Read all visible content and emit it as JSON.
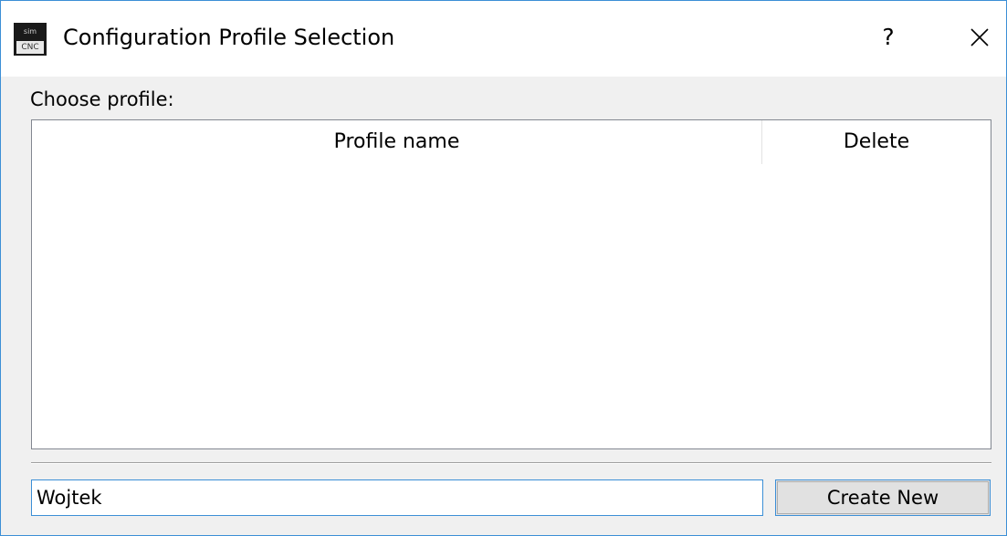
{
  "window": {
    "title": "Configuration Profile Selection",
    "app_icon": {
      "top_text": "sim",
      "bottom_text": "CNC"
    },
    "help_label": "?",
    "close_icon": "close-icon"
  },
  "content": {
    "choose_label": "Choose profile:",
    "table": {
      "columns": [
        "Profile name",
        "Delete"
      ],
      "rows": []
    },
    "name_input": {
      "value": "Wojtek"
    },
    "create_button_label": "Create New"
  },
  "colors": {
    "accent": "#3c8fd6",
    "title_bg": "#ffffff",
    "dialog_bg": "#f0f0f0"
  }
}
